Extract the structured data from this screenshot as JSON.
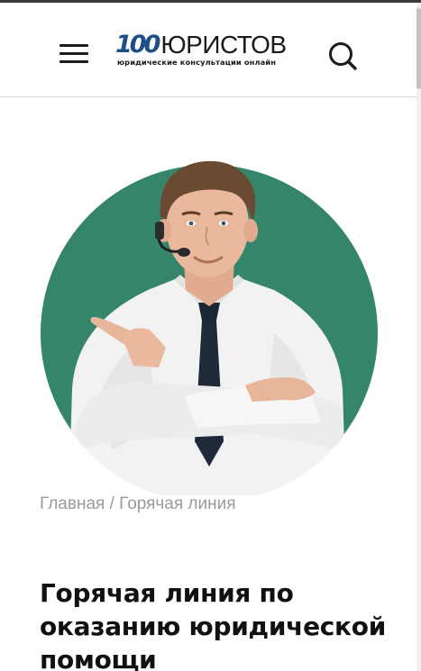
{
  "header": {
    "logo": {
      "number": "100",
      "word": "ЮРИСТОВ",
      "tagline": "юридические консультации онлайн"
    },
    "menu_icon": "hamburger-menu-icon",
    "search_icon": "search-icon"
  },
  "hero": {
    "image": "operator-with-headset-pointing",
    "circle_color": "#35856a"
  },
  "breadcrumb": {
    "home": "Главная",
    "separator": " / ",
    "current": "Горячая линия"
  },
  "page": {
    "title": "Горячая линия по оказанию юридической помощи"
  },
  "colors": {
    "logo_blue": "#1c4f86",
    "accent_green": "#35856a",
    "breadcrumb_gray": "#9a9a9a"
  }
}
